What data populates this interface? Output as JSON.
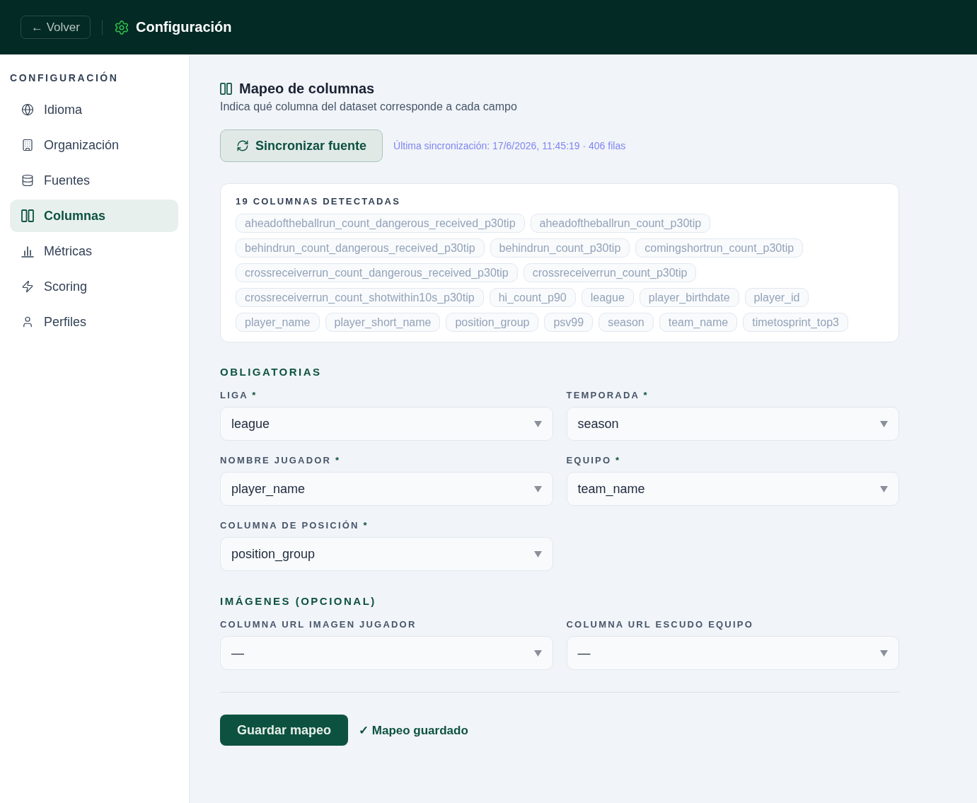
{
  "header": {
    "back_button": "← Volver",
    "title": "Configuración"
  },
  "sidebar": {
    "heading": "CONFIGURACIÓN",
    "items": [
      {
        "label": "Idioma",
        "selected": false
      },
      {
        "label": "Organización",
        "selected": false
      },
      {
        "label": "Fuentes",
        "selected": false
      },
      {
        "label": "Columnas",
        "selected": true
      },
      {
        "label": "Métricas",
        "selected": false
      },
      {
        "label": "Scoring",
        "selected": false
      },
      {
        "label": "Perfiles",
        "selected": false
      }
    ]
  },
  "page": {
    "title": "Mapeo de columnas",
    "subtitle": "Indica qué columna del dataset corresponde a cada campo"
  },
  "sync": {
    "button": "Sincronizar fuente",
    "status": "Última sincronización: 17/6/2026, 11:45:19 · 406 filas"
  },
  "detected": {
    "heading": "19 COLUMNAS DETECTADAS",
    "columns": [
      "aheadoftheballrun_count_dangerous_received_p30tip",
      "aheadoftheballrun_count_p30tip",
      "behindrun_count_dangerous_received_p30tip",
      "behindrun_count_p30tip",
      "comingshortrun_count_p30tip",
      "crossreceiverrun_count_dangerous_received_p30tip",
      "crossreceiverrun_count_p30tip",
      "crossreceiverrun_count_shotwithin10s_p30tip",
      "hi_count_p90",
      "league",
      "player_birthdate",
      "player_id",
      "player_name",
      "player_short_name",
      "position_group",
      "psv99",
      "season",
      "team_name",
      "timetosprint_top3"
    ]
  },
  "sections": [
    {
      "heading": "OBLIGATORIAS",
      "fields": [
        {
          "label": "LIGA",
          "required_mark": "*",
          "value": "league"
        },
        {
          "label": "TEMPORADA",
          "required_mark": "*",
          "value": "season"
        },
        {
          "label": "NOMBRE JUGADOR",
          "required_mark": "*",
          "value": "player_name"
        },
        {
          "label": "EQUIPO",
          "required_mark": "*",
          "value": "team_name"
        },
        {
          "label": "COLUMNA DE POSICIÓN",
          "required_mark": "*",
          "value": "position_group"
        }
      ]
    },
    {
      "heading": "IMÁGENES (OPCIONAL)",
      "fields": [
        {
          "label": "COLUMNA URL IMAGEN JUGADOR",
          "value": "—"
        },
        {
          "label": "COLUMNA URL ESCUDO EQUIPO",
          "value": "—"
        }
      ]
    }
  ],
  "footer": {
    "save_button": "Guardar mapeo",
    "status": "✓ Mapeo guardado"
  }
}
